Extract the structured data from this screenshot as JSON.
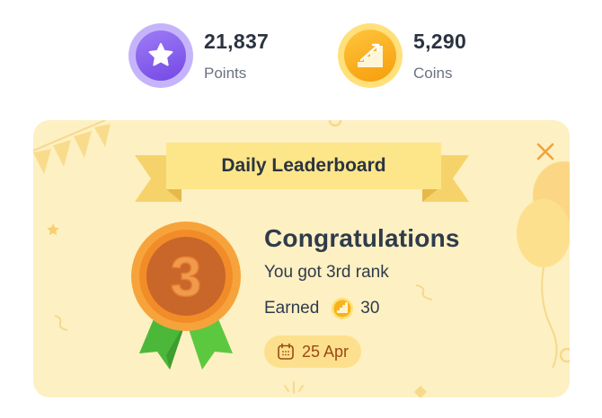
{
  "stats": {
    "points": {
      "value": "21,837",
      "label": "Points",
      "icon": "star-icon"
    },
    "coins": {
      "value": "5,290",
      "label": "Coins",
      "icon": "stairs-coin-icon"
    }
  },
  "card": {
    "ribbon_title": "Daily Leaderboard",
    "title": "Congratulations",
    "rank_text": "You got 3rd rank",
    "earned_label": "Earned",
    "earned_amount": "30",
    "date": "25 Apr",
    "medal_number": "3",
    "close_icon": "close-icon",
    "calendar_icon": "calendar-icon"
  },
  "colors": {
    "card_bg": "#fdf0c2",
    "ribbon": "#fde68a",
    "medal_orange": "#f28c28",
    "medal_ribbon_green": "#4cb83a",
    "points_purple": "#7c52e8",
    "coins_orange": "#f8b21c",
    "close": "#f2a23a"
  }
}
